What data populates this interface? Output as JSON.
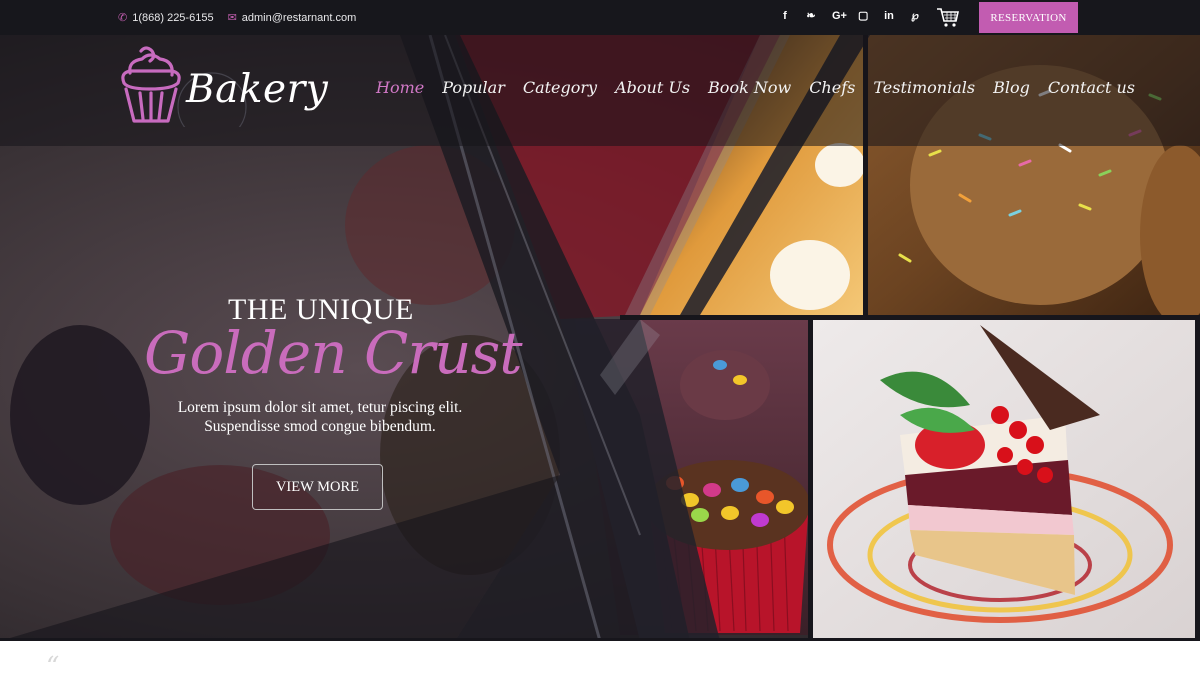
{
  "topbar": {
    "phone": "1(868) 225-6155",
    "email": "admin@restarnant.com",
    "phone_icon": "phone-icon",
    "email_icon": "envelope-icon",
    "social": [
      {
        "icon": "facebook-icon",
        "glyph": "f"
      },
      {
        "icon": "twitter-icon",
        "glyph": "❧"
      },
      {
        "icon": "google-plus-icon",
        "glyph": "G+"
      },
      {
        "icon": "instagram-icon",
        "glyph": "▢"
      },
      {
        "icon": "linkedin-icon",
        "glyph": "in"
      },
      {
        "icon": "pinterest-icon",
        "glyph": "℘"
      }
    ],
    "cart_icon": "shopping-cart-icon",
    "reservation_label": "RESERVATION"
  },
  "brand": {
    "name": "Bakery",
    "logo_icon": "cupcake-icon"
  },
  "nav": {
    "items": [
      "Home",
      "Popular",
      "Category",
      "About Us",
      "Book Now",
      "Chefs",
      "Testimonials",
      "Blog",
      "Contact us"
    ],
    "active": "Home"
  },
  "hero": {
    "eyebrow": "THE UNIQUE",
    "headline": "Golden Crust",
    "lead_line1": "Lorem ipsum dolor sit amet, tetur piscing elit.",
    "lead_line2": "Suspendisse smod congue bibendum.",
    "cta_label": "VIEW MORE"
  },
  "below": {
    "quote_icon": "quote-icon",
    "quote_glyph": "“"
  },
  "colors": {
    "accent": "#c25cb1",
    "topbar": "#17171c",
    "active_nav": "#d178c6"
  }
}
